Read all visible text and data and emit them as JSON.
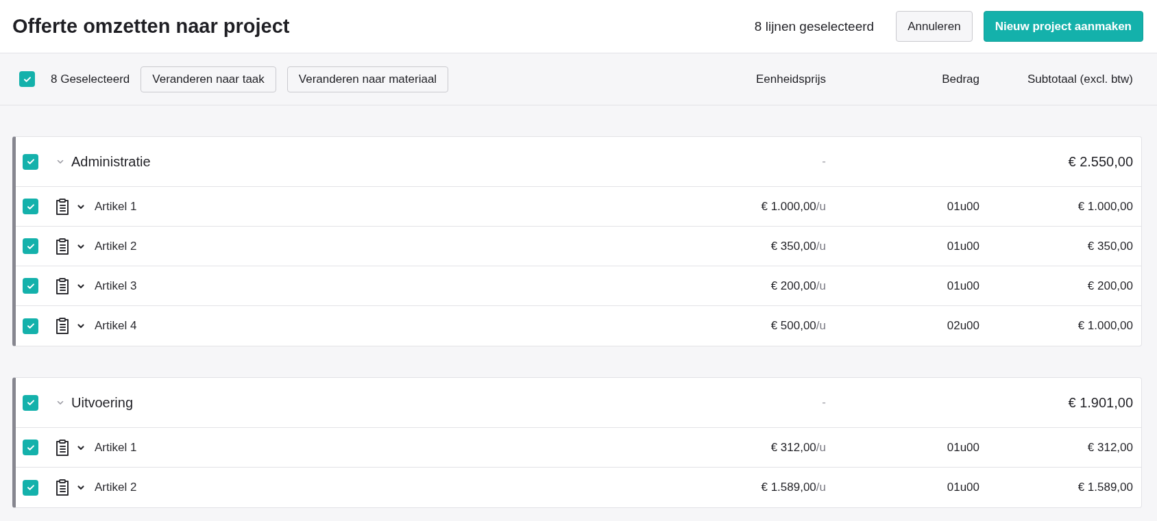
{
  "header": {
    "title": "Offerte omzetten naar project",
    "selection_count": "8 lijnen geselecteerd",
    "buttons": [
      {
        "label": "Annuleren",
        "kind": "secondary"
      },
      {
        "label": "Nieuw project aanmaken",
        "kind": "primary"
      }
    ]
  },
  "toolbar": {
    "checked": true,
    "selected_label": "8 Geselecteerd",
    "actions": [
      "Veranderen naar taak",
      "Veranderen naar materiaal"
    ],
    "columns": [
      "Eenheidsprijs",
      "Bedrag",
      "Subtotaal (excl. btw)"
    ]
  },
  "groups": [
    {
      "name": "Administratie",
      "checked": true,
      "expanded": true,
      "unit_price": "-",
      "subtotal": "€ 2.550,00",
      "rows": [
        {
          "name": "Artikel 1",
          "checked": true,
          "expanded": false,
          "price": "€ 1.000,00",
          "unit": "/u",
          "amount": "01u00",
          "subtotal": "€ 1.000,00"
        },
        {
          "name": "Artikel 2",
          "checked": true,
          "expanded": false,
          "price": "€ 350,00",
          "unit": "/u",
          "amount": "01u00",
          "subtotal": "€ 350,00"
        },
        {
          "name": "Artikel 3",
          "checked": true,
          "expanded": false,
          "price": "€ 200,00",
          "unit": "/u",
          "amount": "01u00",
          "subtotal": "€ 200,00"
        },
        {
          "name": "Artikel 4",
          "checked": true,
          "expanded": false,
          "price": "€ 500,00",
          "unit": "/u",
          "amount": "02u00",
          "subtotal": "€ 1.000,00"
        }
      ]
    },
    {
      "name": "Uitvoering",
      "checked": true,
      "expanded": true,
      "unit_price": "-",
      "subtotal": "€ 1.901,00",
      "rows": [
        {
          "name": "Artikel 1",
          "checked": true,
          "expanded": false,
          "price": "€ 312,00",
          "unit": "/u",
          "amount": "01u00",
          "subtotal": "€ 312,00"
        },
        {
          "name": "Artikel 2",
          "checked": true,
          "expanded": false,
          "price": "€ 1.589,00",
          "unit": "/u",
          "amount": "01u00",
          "subtotal": "€ 1.589,00"
        }
      ]
    }
  ]
}
